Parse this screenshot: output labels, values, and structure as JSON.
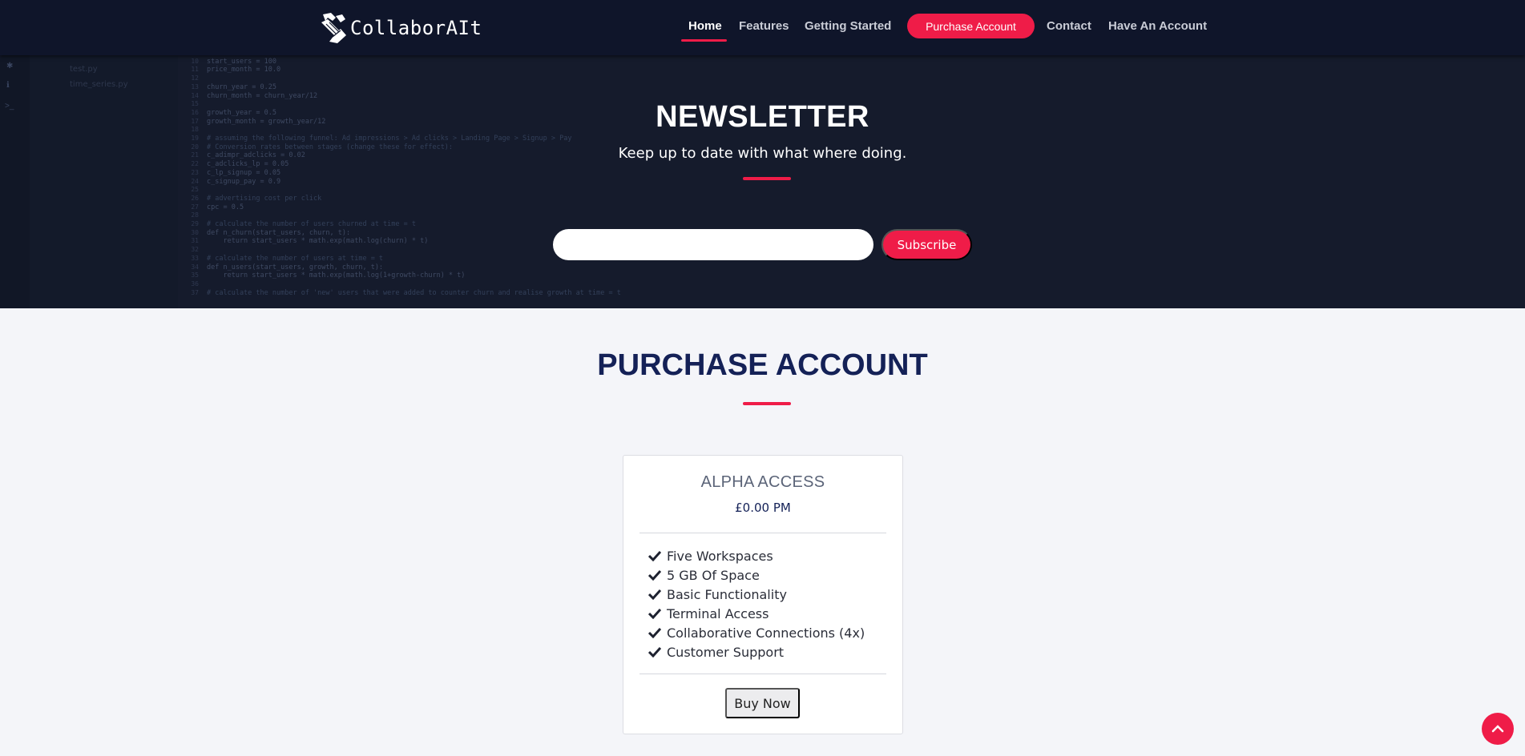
{
  "brand": {
    "name": "CollaborAIt",
    "icon": "hand-shake-logo-icon"
  },
  "nav": {
    "items": [
      {
        "label": "Home",
        "active": true
      },
      {
        "label": "Features"
      },
      {
        "label": "Getting Started"
      },
      {
        "label": "Purchase Account",
        "button": true
      },
      {
        "label": "Contact"
      },
      {
        "label": "Have An Account"
      }
    ]
  },
  "newsletter": {
    "title": "NEWSLETTER",
    "subtitle": "Keep up to date with what where doing.",
    "email_value": "",
    "subscribe_label": "Subscribe",
    "background_code": {
      "files": [
        "test.py",
        "time_series.py"
      ],
      "lines": [
        "#",
        "start_users = 100",
        "price_month = 10.0",
        "",
        "churn_year = 0.25",
        "churn_month = churn_year/12",
        "",
        "growth_year = 0.5",
        "growth_month = growth_year/12",
        "",
        "# assuming the following funnel: Ad impressions > Ad clicks > Landing Page > Signup > Pay",
        "# Conversion rates between stages (change these for effect):",
        "c_adimpr_adclicks = 0.02",
        "c_adclicks_lp = 0.05",
        "c_lp_signup = 0.05",
        "c_signup_pay = 0.9",
        "",
        "# advertising cost per click",
        "cpc = 0.5",
        "",
        "# calculate the number of users churned at time = t",
        "def n_churn(start_users, churn, t):",
        "    return start_users * math.exp(math.log(churn) * t)",
        "",
        "# calculate the number of users at time = t",
        "def n_users(start_users, growth, churn, t):",
        "    return start_users * math.exp(math.log(1+growth-churn) * t)",
        "",
        "# calculate the number of 'new' users that were added to counter churn and realise growth at time = t"
      ]
    }
  },
  "purchase": {
    "title": "PURCHASE ACCOUNT",
    "card": {
      "name": "ALPHA ACCESS",
      "price": "£0.00 PM",
      "features": [
        "Five Workspaces",
        "5 GB Of Space",
        "Basic Functionality",
        "Terminal Access",
        "Collaborative Connections (4x)",
        "Customer Support"
      ],
      "buy_label": "Buy Now"
    }
  },
  "scroll_top_icon": "chevron-up-icon",
  "colors": {
    "accent": "#ef1c48",
    "navbar": "#0f152a",
    "heading": "#142157",
    "page_bg": "#f4f5f9"
  }
}
